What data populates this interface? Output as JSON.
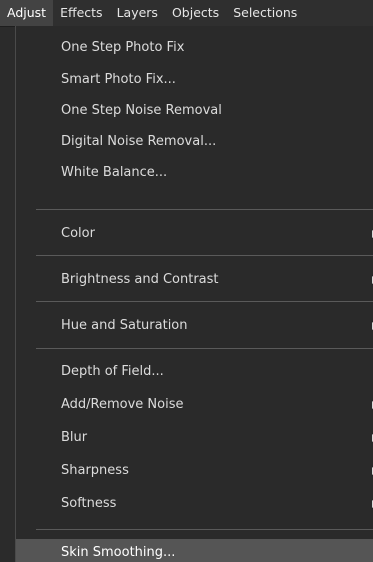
{
  "menubar": {
    "items": [
      {
        "label": "Adjust"
      },
      {
        "label": "Effects"
      },
      {
        "label": "Layers"
      },
      {
        "label": "Objects"
      },
      {
        "label": "Selections"
      }
    ]
  },
  "adjust_menu": {
    "items": [
      {
        "label": "One Step Photo Fix"
      },
      {
        "label": "Smart Photo Fix..."
      },
      {
        "label": "One Step Noise Removal"
      },
      {
        "label": "Digital Noise Removal..."
      },
      {
        "label": "White Balance..."
      },
      {
        "label": "Color"
      },
      {
        "label": "Brightness and Contrast"
      },
      {
        "label": "Hue and Saturation"
      },
      {
        "label": "Depth of Field..."
      },
      {
        "label": "Add/Remove Noise"
      },
      {
        "label": "Blur"
      },
      {
        "label": "Sharpness"
      },
      {
        "label": "Softness"
      },
      {
        "label": "Skin Smoothing..."
      }
    ]
  },
  "colors": {
    "menu_background": "#2a2a2a",
    "highlight": "#555555",
    "active_menubar": "#434343",
    "text": "#dcdcdc"
  }
}
